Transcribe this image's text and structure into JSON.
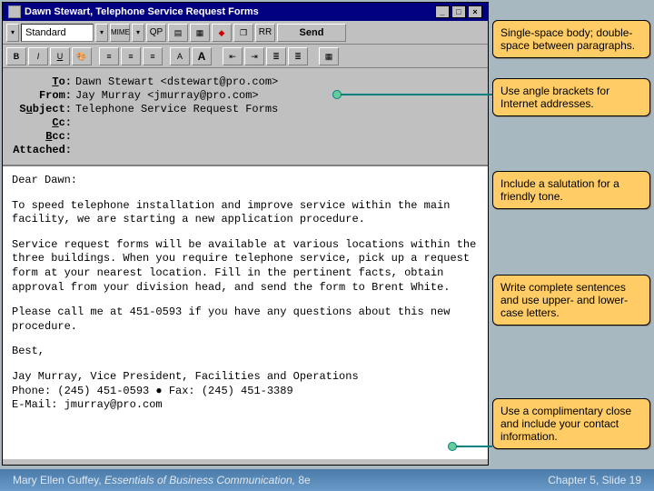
{
  "window": {
    "title": "Dawn Stewart, Telephone Service Request Forms",
    "min": "_",
    "max": "□",
    "close": "×"
  },
  "toolbar": {
    "style_select": "Standard",
    "mime": "MIME",
    "qp": "QP",
    "rr": "RR",
    "send": "Send",
    "b": "B",
    "i": "I",
    "u": "U",
    "aup": "A",
    "adn": "A"
  },
  "headers": {
    "to_label": "To:",
    "to_val": "Dawn Stewart <dstewart@pro.com>",
    "from_label": "From:",
    "from_val": "Jay Murray <jmurray@pro.com>",
    "subj_label": "Subject:",
    "subj_val": "Telephone Service Request Forms",
    "cc_label": "Cc:",
    "bcc_label": "Bcc:",
    "attached_label": "Attached:"
  },
  "body": {
    "p1": "Dear Dawn:",
    "p2": "To speed telephone installation and improve service within the main facility, we are starting a new application procedure.",
    "p3": "Service request forms will be available at various locations within the three buildings. When you require telephone service, pick up a request form at your nearest location. Fill in the pertinent facts, obtain approval from your division head, and send the form to Brent White.",
    "p4": "Please call me at 451-0593 if you have any questions about this new procedure.",
    "p5": "Best,",
    "p6a": "Jay Murray, Vice President, Facilities and Operations",
    "p6b": "Phone: (245) 451-0593 ● Fax: (245) 451-3389",
    "p6c": "E-Mail: jmurray@pro.com"
  },
  "callouts": {
    "c1": "Single-space body; double-space between paragraphs.",
    "c2": "Use angle brackets for Internet addresses.",
    "c3": "Include a salutation for a friendly tone.",
    "c4": "Write complete sentences and use upper- and lower-case letters.",
    "c5": "Use a complimentary close and include your contact information."
  },
  "footer": {
    "author": "Mary Ellen Guffey, ",
    "title": "Essentials of Business Communication, ",
    "ed": "8e",
    "slide": "Chapter 5, Slide 19"
  }
}
